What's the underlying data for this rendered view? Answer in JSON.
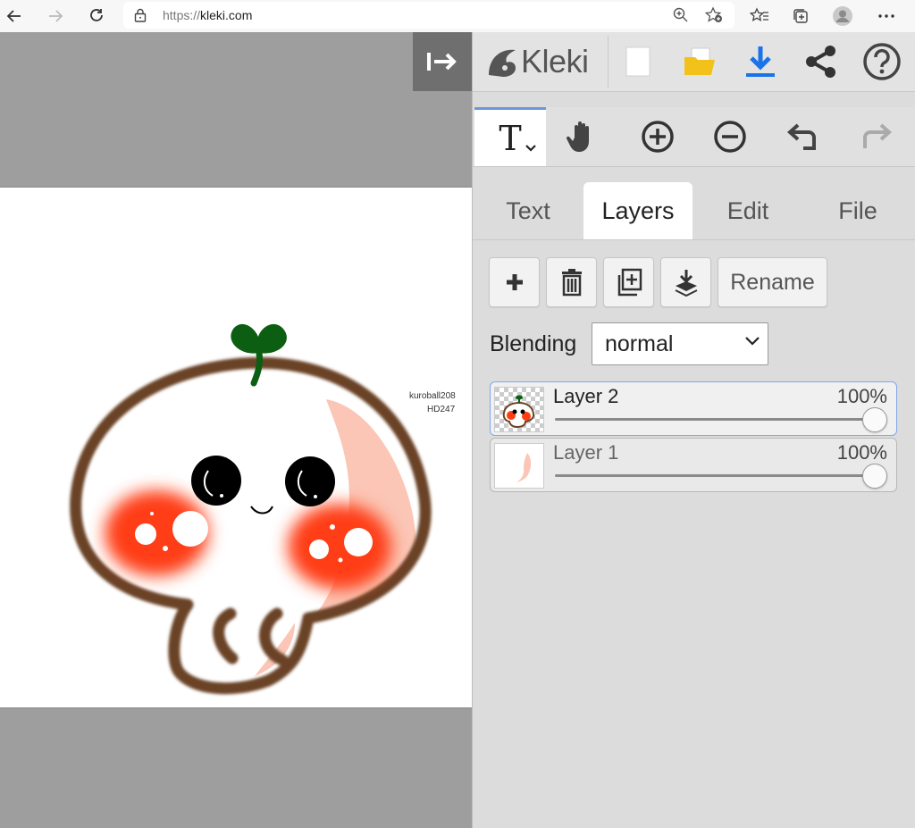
{
  "browser": {
    "url_scheme": "https://",
    "url_host": "kleki.com"
  },
  "canvas": {
    "watermark_line1": "kuroball208",
    "watermark_line2": "HD247"
  },
  "app": {
    "logo_text": "Kleki"
  },
  "tabs": [
    {
      "label": "Text"
    },
    {
      "label": "Layers"
    },
    {
      "label": "Edit"
    },
    {
      "label": "File"
    }
  ],
  "active_tab": "Layers",
  "layer_actions": {
    "rename_label": "Rename"
  },
  "blending": {
    "label": "Blending",
    "value": "normal"
  },
  "layers": [
    {
      "name": "Layer 2",
      "opacity": "100%",
      "opacity_value": 1.0,
      "selected": true
    },
    {
      "name": "Layer 1",
      "opacity": "100%",
      "opacity_value": 1.0,
      "selected": false
    }
  ],
  "colors": {
    "accent": "#6c97d8",
    "download_blue": "#1a73e8",
    "folder_yellow": "#f2c21b",
    "mascot_outline": "#6b4326",
    "cheek_red": "#ff3d12",
    "sprout_green": "#0b5e12"
  },
  "icons": {
    "tool_active": "text-tool-icon",
    "tool_hand": "hand-icon",
    "zoom_in": "zoom-in-icon",
    "zoom_out": "zoom-out-icon",
    "undo": "undo-icon",
    "redo": "redo-icon"
  }
}
